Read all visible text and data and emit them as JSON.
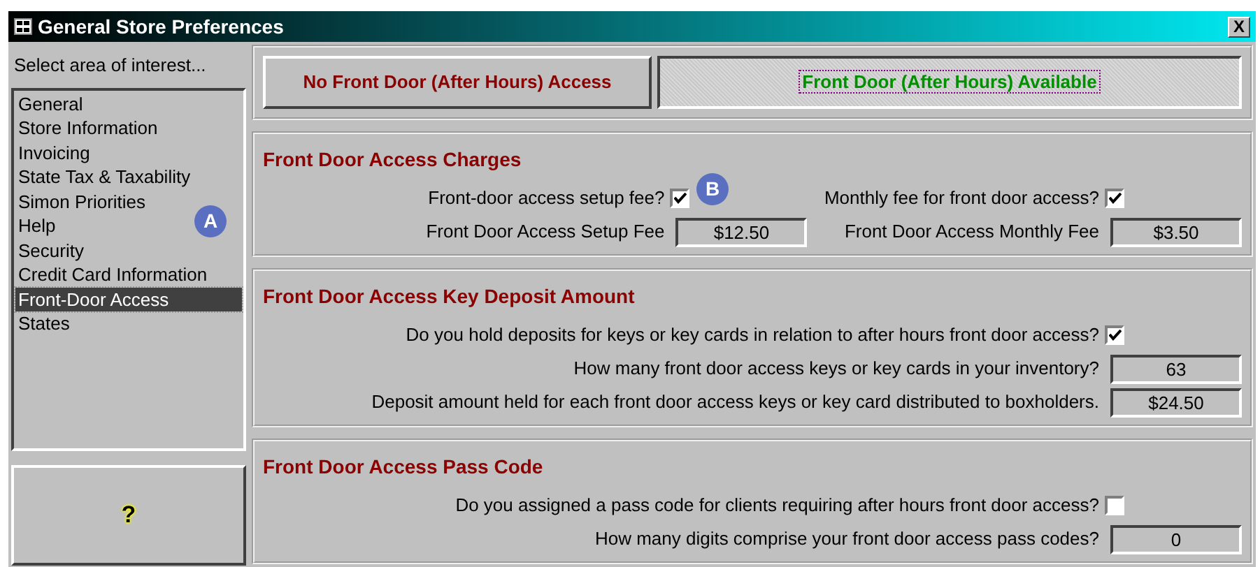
{
  "window": {
    "title": "General Store Preferences",
    "close": "X"
  },
  "sidebar": {
    "label": "Select area of interest...",
    "items": [
      {
        "label": "General",
        "selected": false
      },
      {
        "label": "Store Information",
        "selected": false
      },
      {
        "label": "Invoicing",
        "selected": false
      },
      {
        "label": "State Tax & Taxability",
        "selected": false
      },
      {
        "label": "Simon Priorities",
        "selected": false
      },
      {
        "label": "Help",
        "selected": false
      },
      {
        "label": "Security",
        "selected": false
      },
      {
        "label": "Credit Card Information",
        "selected": false
      },
      {
        "label": "Front-Door Access",
        "selected": true
      },
      {
        "label": "States",
        "selected": false
      }
    ],
    "help_button": "?"
  },
  "access_toggle": {
    "options": [
      {
        "label": "No Front Door (After Hours) Access",
        "selected": false
      },
      {
        "label": "Front Door (After Hours) Available",
        "selected": true
      }
    ]
  },
  "sections": [
    {
      "title": "Front Door Access Charges",
      "columns": [
        {
          "rows": [
            {
              "kind": "checkbox",
              "label": "Front-door access setup fee?",
              "checked": true
            },
            {
              "kind": "field",
              "label": "Front Door Access Setup Fee",
              "value": "$12.50"
            }
          ]
        },
        {
          "rows": [
            {
              "kind": "checkbox",
              "label": "Monthly fee for front door access?",
              "checked": true
            },
            {
              "kind": "field",
              "label": "Front Door Access Monthly Fee",
              "value": "$3.50"
            }
          ]
        }
      ]
    },
    {
      "title": "Front Door Access Key Deposit Amount",
      "columns": [
        {
          "rows": [
            {
              "kind": "checkbox",
              "label": "Do you hold deposits for keys or key cards in relation to after hours front door access?",
              "checked": true
            },
            {
              "kind": "field",
              "label": "How many front door access keys or key cards in your inventory?",
              "value": "63"
            },
            {
              "kind": "field",
              "label": "Deposit amount held for each front door access keys or key card distributed to boxholders.",
              "value": "$24.50"
            }
          ]
        }
      ]
    },
    {
      "title": "Front Door Access Pass Code",
      "columns": [
        {
          "rows": [
            {
              "kind": "checkbox",
              "label": "Do you assigned a pass code for clients requiring after hours front door access?",
              "checked": false
            },
            {
              "kind": "field",
              "label": "How many digits comprise your front door access pass codes?",
              "value": "0"
            }
          ]
        }
      ]
    }
  ],
  "callouts": [
    "A",
    "B"
  ]
}
